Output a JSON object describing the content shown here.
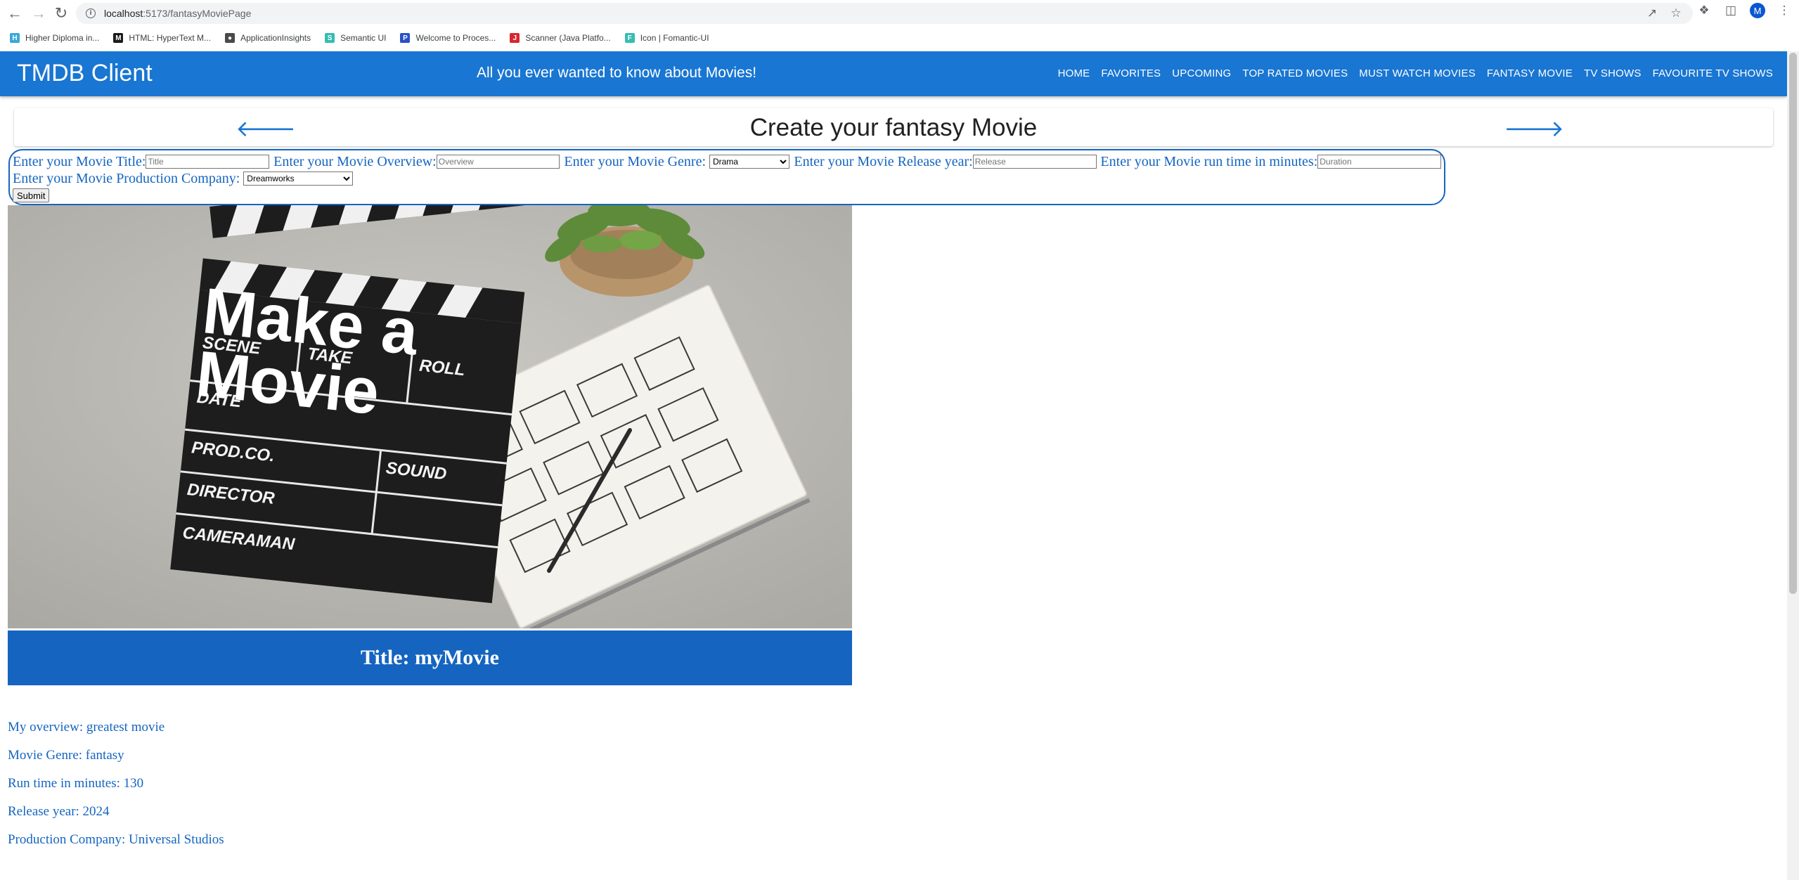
{
  "browser": {
    "url_host": "localhost",
    "url_path": ":5173/fantasyMoviePage",
    "avatar_letter": "M",
    "bookmarks": [
      {
        "label": "Higher Diploma in...",
        "color": "#3aa8d8",
        "icon": "H"
      },
      {
        "label": "HTML: HyperText M...",
        "color": "#1b1b1b",
        "icon": "M"
      },
      {
        "label": "ApplicationInsights",
        "color": "#4a4a4a",
        "icon": "●"
      },
      {
        "label": "Semantic UI",
        "color": "#35bdb2",
        "icon": "S"
      },
      {
        "label": "Welcome to Proces...",
        "color": "#2a50c8",
        "icon": "P"
      },
      {
        "label": "Scanner (Java Platfo...",
        "color": "#d8262e",
        "icon": "J"
      },
      {
        "label": "Icon | Fomantic-UI",
        "color": "#35bdb2",
        "icon": "F"
      }
    ]
  },
  "header": {
    "title": "TMDB Client",
    "tagline": "All you ever wanted to know about Movies!",
    "nav": [
      "Home",
      "Favorites",
      "Upcoming",
      "Top Rated Movies",
      "Must Watch Movies",
      "Fantasy Movie",
      "TV Shows",
      "Favourite TV Shows"
    ]
  },
  "page": {
    "title": "Create your fantasy Movie"
  },
  "form": {
    "title_label": "Enter your Movie Title:",
    "title_placeholder": "Title",
    "overview_label": "Enter your Movie Overview:",
    "overview_placeholder": "Overview",
    "genre_label": "Enter your Movie Genre:",
    "genre_selected": "Drama",
    "release_label": "Enter your Movie Release year:",
    "release_placeholder": "Release",
    "runtime_label": "Enter your Movie run time in minutes:",
    "runtime_placeholder": "Duration",
    "company_label": "Enter your Movie Production Company:",
    "company_selected": "Dreamworks",
    "submit_label": "Submit"
  },
  "hero": {
    "line1": "Make a",
    "line2": "Movie",
    "slate_scene": "SCENE",
    "slate_take": "TAKE",
    "slate_roll": "ROLL",
    "slate_date": "DATE",
    "slate_sound": "SOUND",
    "slate_prodco": "PROD.CO.",
    "slate_director": "DIRECTOR",
    "slate_cameraman": "CAMERAMAN"
  },
  "movie": {
    "title_line": "Title: myMovie",
    "overview_line": "My overview: greatest movie",
    "genre_line": "Movie Genre: fantasy",
    "runtime_line": "Run time in minutes: 130",
    "release_line": "Release year: 2024",
    "company_line": "Production Company: Universal Studios"
  },
  "colors": {
    "primary": "#1976d2",
    "banner": "#1565c0"
  }
}
